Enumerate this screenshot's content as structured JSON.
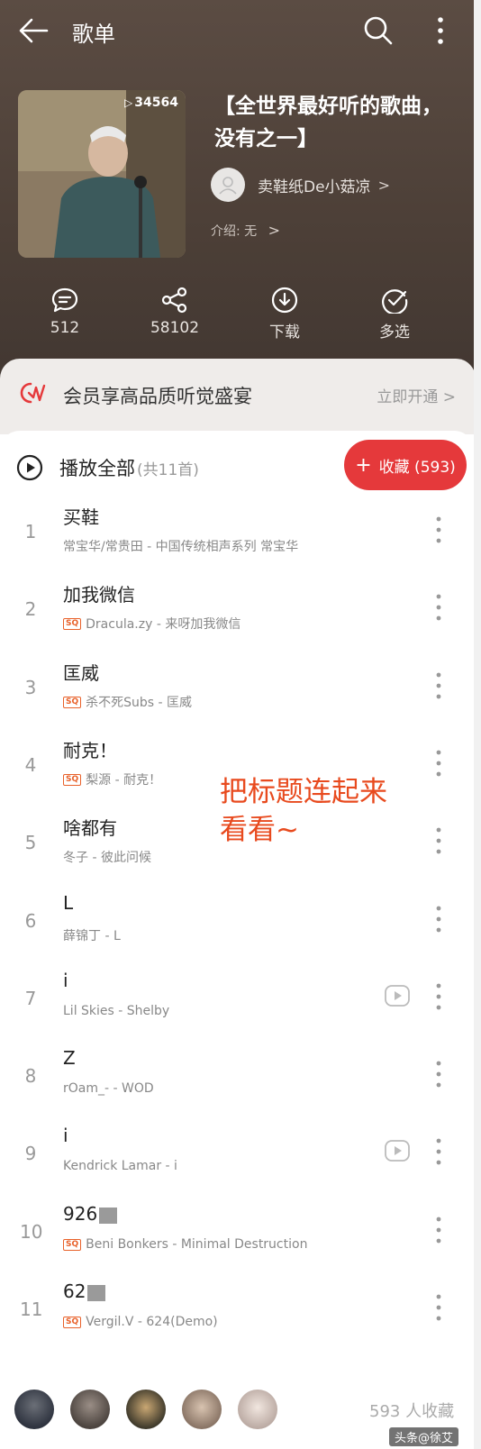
{
  "header": {
    "title": "歌单"
  },
  "playlist": {
    "play_count": "34564",
    "title": "【全世界最好听的歌曲，没有之一】",
    "creator": "卖鞋纸De小菇凉",
    "intro": "介绍: 无"
  },
  "actions": [
    {
      "icon": "comment-icon",
      "label": "512"
    },
    {
      "icon": "share-icon",
      "label": "58102"
    },
    {
      "icon": "download-icon",
      "label": "下载"
    },
    {
      "icon": "multiselect-icon",
      "label": "多选"
    }
  ],
  "vip": {
    "text": "会员享高品质听觉盛宴",
    "link": "立即开通"
  },
  "list": {
    "play_all": "播放全部",
    "count": "(共11首)",
    "fav_button": "收藏 (593)"
  },
  "songs": [
    {
      "num": "1",
      "title": "买鞋",
      "sub": "常宝华/常贵田 - 中国传统相声系列 常宝华",
      "sq": false,
      "mv": false
    },
    {
      "num": "2",
      "title": "加我微信",
      "sub": "Dracula.zy - 来呀加我微信",
      "sq": true,
      "mv": false
    },
    {
      "num": "3",
      "title": "匡威",
      "sub": "杀不死Subs - 匡威",
      "sq": true,
      "mv": false
    },
    {
      "num": "4",
      "title": "耐克！",
      "sub": "梨源 - 耐克！",
      "sq": true,
      "mv": false
    },
    {
      "num": "5",
      "title": "啥都有",
      "sub": "冬子 - 彼此问候",
      "sq": false,
      "mv": false
    },
    {
      "num": "6",
      "title": "L",
      "sub": "薛锦丁 - L",
      "sq": false,
      "mv": false
    },
    {
      "num": "7",
      "title": "i",
      "sub": "Lil Skies - Shelby",
      "sq": false,
      "mv": true
    },
    {
      "num": "8",
      "title": "Z",
      "sub": "rOam_- - WOD",
      "sq": false,
      "mv": false
    },
    {
      "num": "9",
      "title": "i",
      "sub": "Kendrick Lamar - i",
      "sq": false,
      "mv": true
    },
    {
      "num": "10",
      "title": "926",
      "sub": "Beni Bonkers - Minimal Destruction",
      "sq": true,
      "mv": false
    },
    {
      "num": "11",
      "title": "62",
      "sub": "Vergil.V - 624(Demo)",
      "sq": true,
      "mv": false
    }
  ],
  "overlay": {
    "line1": "把标题连起来",
    "line2": "看看~"
  },
  "bottom": {
    "fav_count": "593 人收藏",
    "watermark": "头条@徐艾"
  }
}
